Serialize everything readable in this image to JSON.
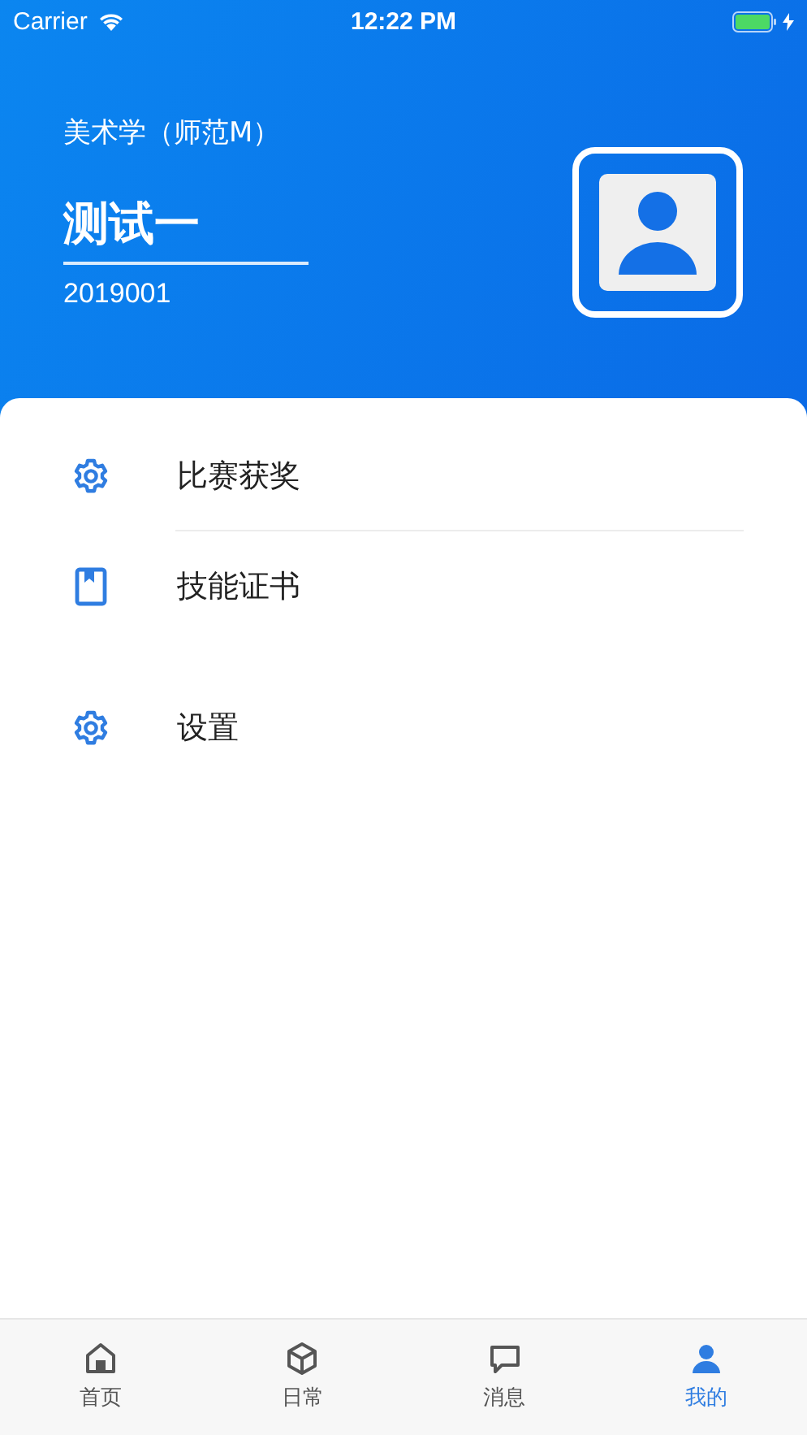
{
  "status_bar": {
    "carrier": "Carrier",
    "time": "12:22 PM",
    "battery_charging": true
  },
  "profile": {
    "major": "美术学（师范M）",
    "name": "测试一",
    "student_id": "2019001"
  },
  "menu_sections": [
    {
      "items": [
        {
          "kind": "gear",
          "label": "比赛获奖"
        },
        {
          "kind": "book",
          "label": "技能证书"
        }
      ]
    },
    {
      "items": [
        {
          "kind": "gear",
          "label": "设置"
        }
      ]
    }
  ],
  "tab_bar": [
    {
      "kind": "home",
      "label": "首页",
      "selected": false
    },
    {
      "kind": "cube",
      "label": "日常",
      "selected": false
    },
    {
      "kind": "chat",
      "label": "消息",
      "selected": false
    },
    {
      "kind": "person",
      "label": "我的",
      "selected": true
    }
  ]
}
